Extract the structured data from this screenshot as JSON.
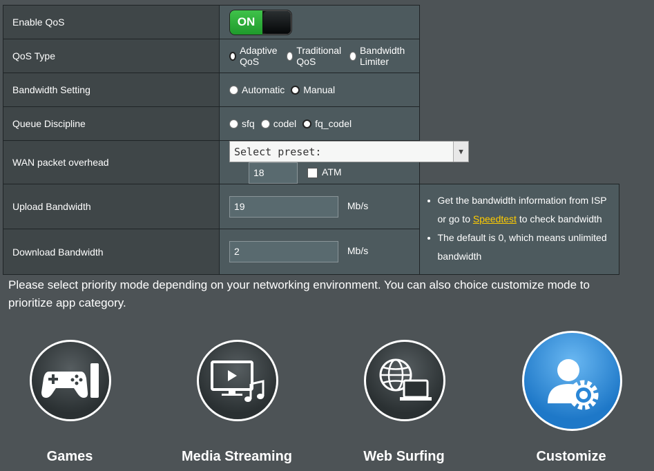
{
  "rows": {
    "enable_qos": {
      "label": "Enable QoS",
      "toggle_text": "ON"
    },
    "qos_type": {
      "label": "QoS Type",
      "options": [
        "Adaptive QoS",
        "Traditional QoS",
        "Bandwidth Limiter"
      ],
      "selected": "Adaptive QoS"
    },
    "bandwidth_setting": {
      "label": "Bandwidth Setting",
      "options": [
        "Automatic",
        "Manual"
      ],
      "selected": "Manual"
    },
    "queue_discipline": {
      "label": "Queue Discipline",
      "options": [
        "sfq",
        "codel",
        "fq_codel"
      ],
      "selected": "fq_codel"
    },
    "wan_overhead": {
      "label": "WAN packet overhead",
      "preset_value": "Select preset:",
      "overhead_value": "18",
      "atm_label": "ATM"
    },
    "upload": {
      "label": "Upload Bandwidth",
      "value": "19",
      "unit": "Mb/s"
    },
    "download": {
      "label": "Download Bandwidth",
      "value": "2",
      "unit": "Mb/s"
    }
  },
  "info": {
    "line1_pre": "Get the bandwidth information from ISP or go to ",
    "link": "Speedtest",
    "line1_post": " to check bandwidth",
    "line2": "The default is 0, which means unlimited bandwidth"
  },
  "description": "Please select priority mode depending on your networking environment. You can also choice customize mode to prioritize app category.",
  "modes": [
    {
      "label": "Games",
      "icon": "gamepad-icon"
    },
    {
      "label": "Media Streaming",
      "icon": "media-streaming-icon"
    },
    {
      "label": "Web Surfing",
      "icon": "web-surfing-icon"
    },
    {
      "label": "Customize",
      "icon": "customize-icon",
      "active": true
    }
  ],
  "colors": {
    "toggle_on": "#2aa838",
    "link": "#ffcc00",
    "active_mode": "#2a86d6"
  }
}
